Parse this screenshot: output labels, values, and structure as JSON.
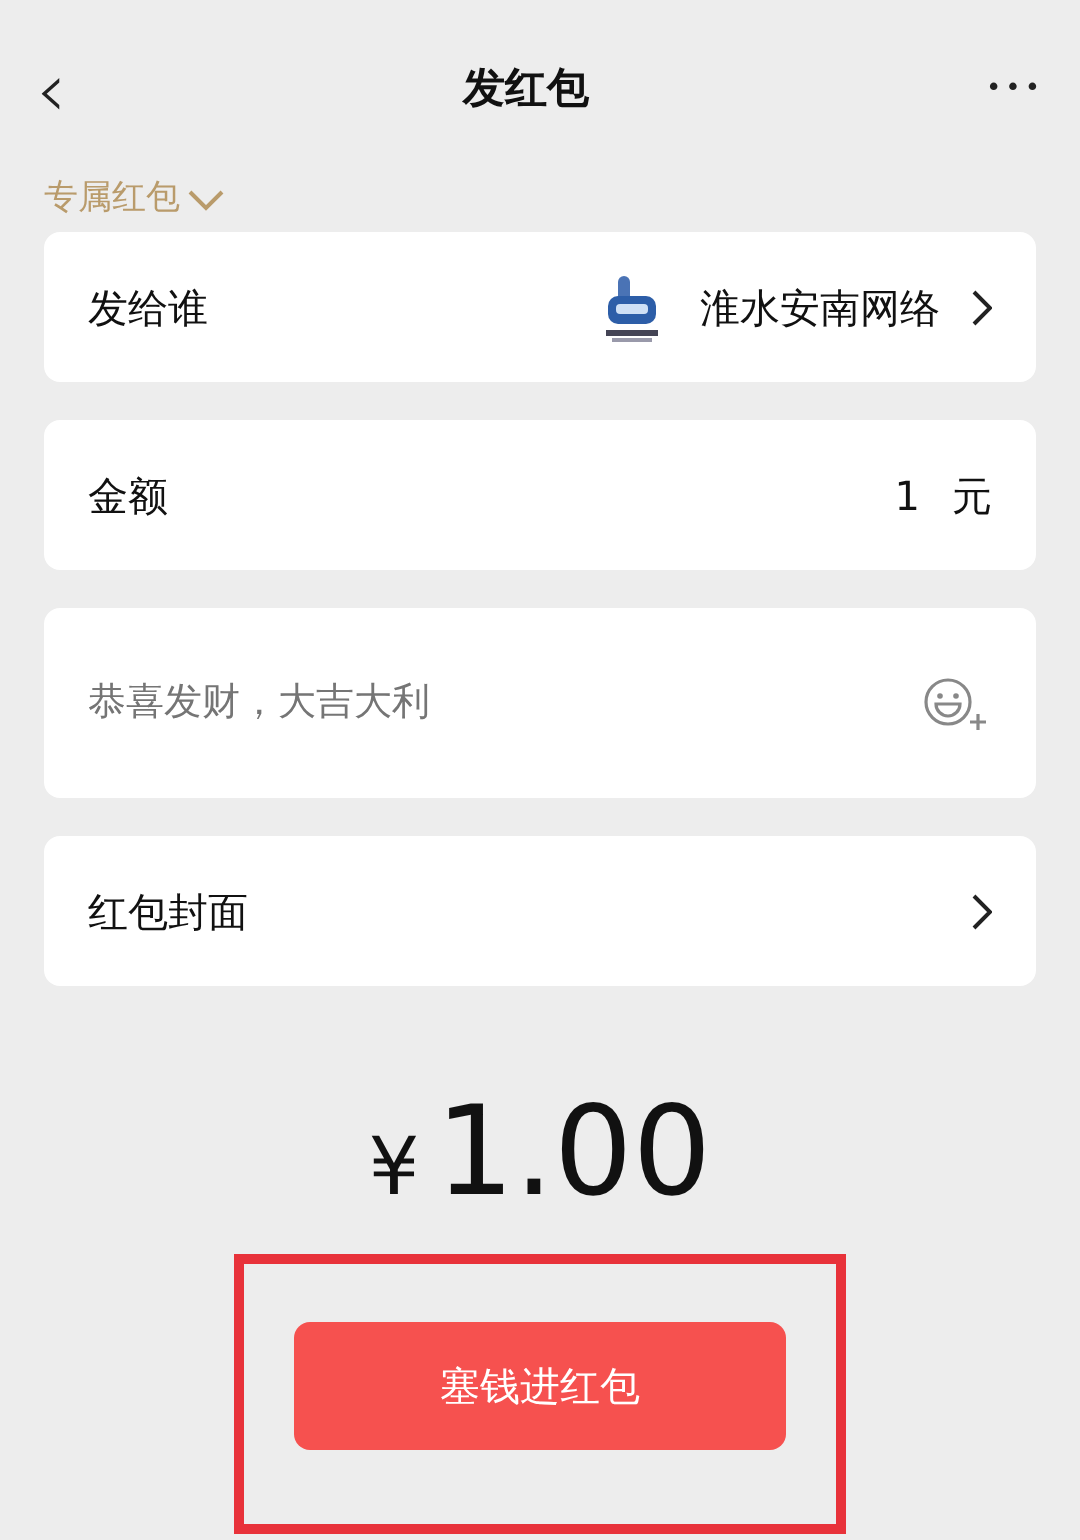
{
  "nav": {
    "back": "‹",
    "title": "发红包",
    "more": "•••"
  },
  "type_selector": {
    "label": "专属红包"
  },
  "rows": [
    {
      "kind": "recipient",
      "label": "发给谁",
      "value": "淮水安南网络"
    },
    {
      "kind": "amount",
      "label": "金额",
      "value": "1",
      "unit": "元"
    },
    {
      "kind": "message",
      "placeholder": "恭喜发财，大吉大利"
    },
    {
      "kind": "cover",
      "label": "红包封面"
    }
  ],
  "total": {
    "currency": "¥",
    "amount": "1.00"
  },
  "submit": {
    "label": "塞钱进红包",
    "highlighted": true
  }
}
